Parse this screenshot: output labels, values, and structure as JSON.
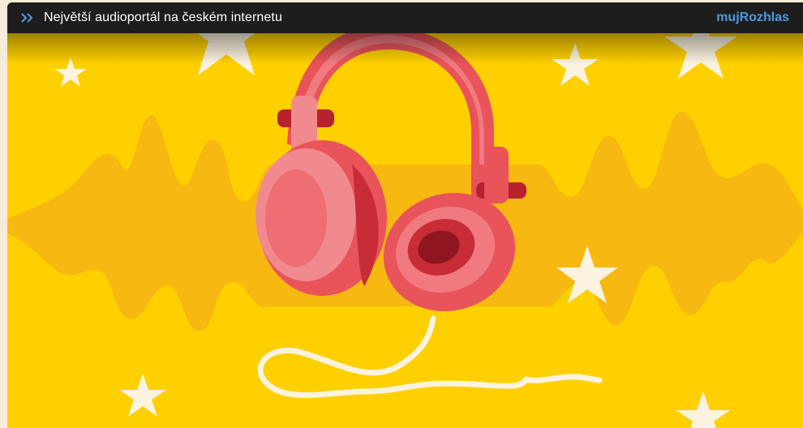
{
  "header": {
    "expand_icon": "double-chevron-right-icon",
    "title": "Největší audioportál na českém internetu",
    "brand": "mujRozhlas"
  },
  "illustration": {
    "subject": "headphones-illustration",
    "colors": {
      "background": "#ffd000",
      "waveform": "#f7b812",
      "headphones": "#e8545a",
      "stars": "#fbf3df"
    }
  }
}
